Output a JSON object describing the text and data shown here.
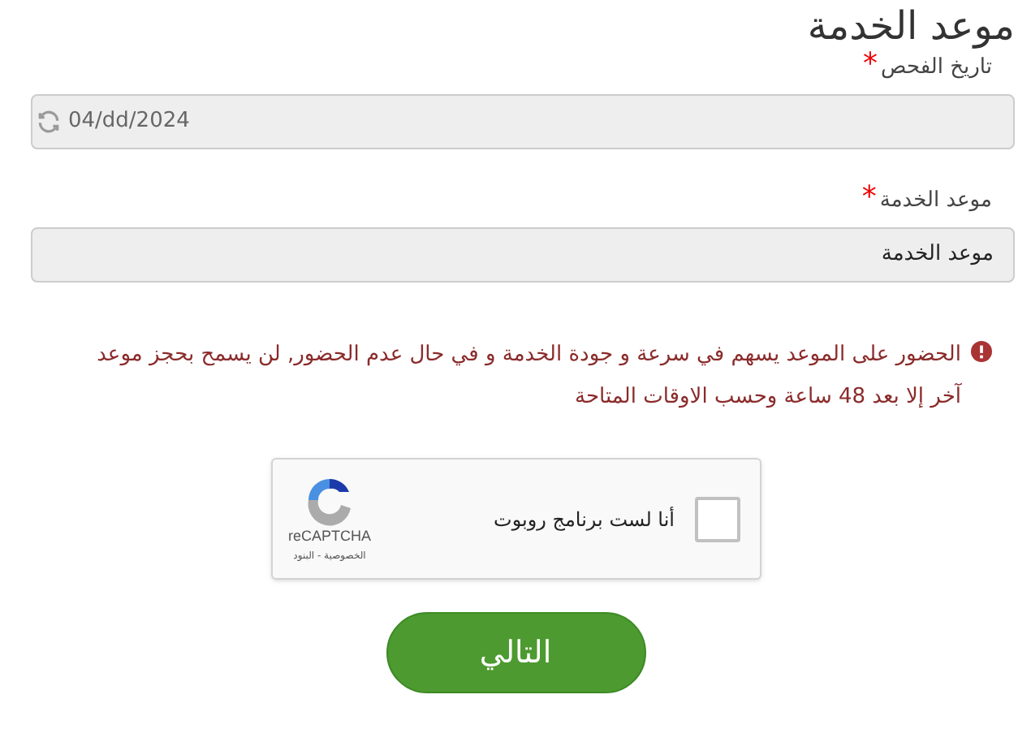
{
  "heading": "موعد الخدمة",
  "fields": [
    {
      "label": "تاريخ الفحص",
      "required": true,
      "value": "04/dd/2024",
      "kind": "date"
    },
    {
      "label": "موعد الخدمة",
      "required": true,
      "value": "موعد الخدمة",
      "kind": "select"
    }
  ],
  "required_mark": "*",
  "notice": "الحضور على الموعد يسهم في سرعة و جودة الخدمة و في حال عدم الحضور, لن يسمح بحجز موعد آخر إلا بعد 48 ساعة وحسب الاوقات المتاحة",
  "captcha": {
    "label": "أنا لست برنامج روبوت",
    "checked": false,
    "brand": "reCAPTCHA",
    "links": "الخصوصية - البنود"
  },
  "next_button": "التالي"
}
